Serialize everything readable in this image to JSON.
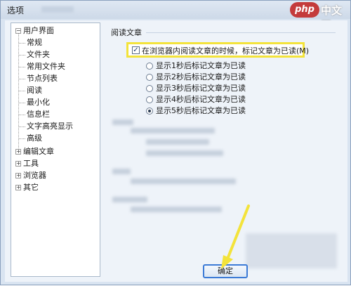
{
  "window": {
    "title": "选项"
  },
  "watermark": {
    "badge": "php",
    "text": "中文网"
  },
  "tree": {
    "items": [
      {
        "label": "用户界面",
        "expander": "−"
      },
      {
        "label": "常规"
      },
      {
        "label": "文件夹"
      },
      {
        "label": "常用文件夹"
      },
      {
        "label": "节点列表"
      },
      {
        "label": "阅读"
      },
      {
        "label": "最小化"
      },
      {
        "label": "信息栏"
      },
      {
        "label": "文字高亮显示"
      },
      {
        "label": "高级"
      },
      {
        "label": "编辑文章",
        "expander": "+"
      },
      {
        "label": "工具",
        "expander": "+"
      },
      {
        "label": "浏览器",
        "expander": "+"
      },
      {
        "label": "其它",
        "expander": "+"
      }
    ]
  },
  "reading": {
    "section_title": "阅读文章",
    "mark_checkbox_label": "在浏览器内阅读文章的时候，标记文章为已读(M)",
    "mark_checkbox_checked": true,
    "check_glyph": "✓",
    "options": [
      {
        "label": "显示1秒后标记文章为已读",
        "selected": false
      },
      {
        "label": "显示2秒后标记文章为已读",
        "selected": false
      },
      {
        "label": "显示3秒后标记文章为已读",
        "selected": false
      },
      {
        "label": "显示4秒后标记文章为已读",
        "selected": false
      },
      {
        "label": "显示5秒后标记文章为已读",
        "selected": true
      }
    ]
  },
  "footer": {
    "ok_label": "确定"
  },
  "colors": {
    "highlight": "#f3e33b",
    "arrow": "#f3e33b",
    "accent": "#3b7ad6"
  }
}
